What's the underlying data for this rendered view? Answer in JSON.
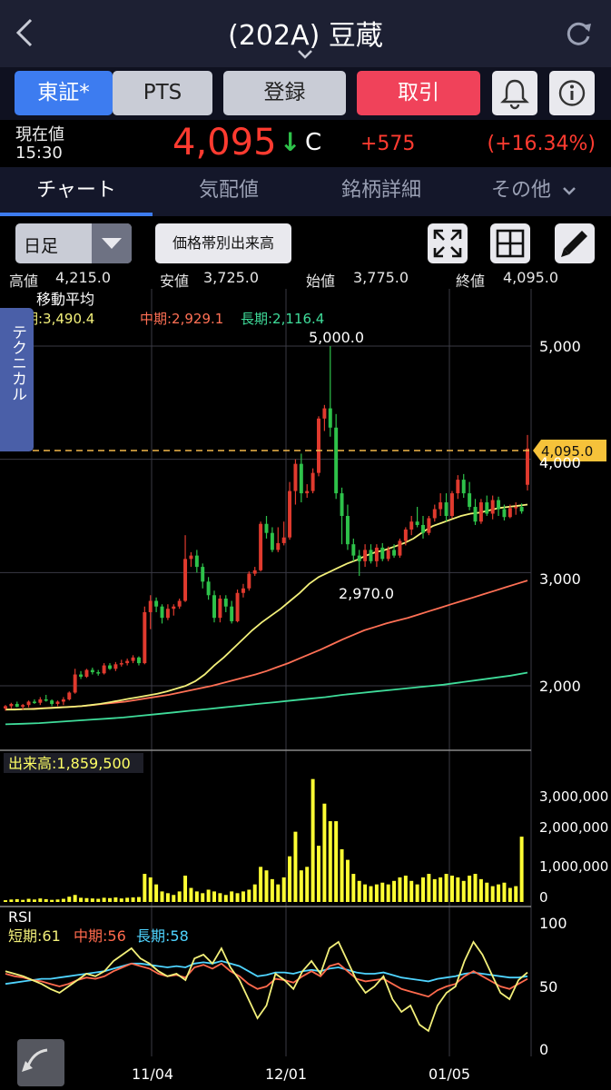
{
  "header": {
    "back_icon": "chevron-left-icon",
    "title": "(202A) 豆蔵",
    "reload_icon": "reload-icon"
  },
  "buttons": {
    "tse": "東証*",
    "pts": "PTS",
    "register": "登録",
    "trade": "取引",
    "bell_icon": "bell-icon",
    "info_icon": "info-icon"
  },
  "quote": {
    "label": "現在値",
    "time": "15:30",
    "price": "4,095",
    "arrow": "↓",
    "flag": "C",
    "change": "+575",
    "change_pct": "(+16.34%)"
  },
  "tabs": [
    {
      "label": "チャート",
      "active": true
    },
    {
      "label": "気配値"
    },
    {
      "label": "銘柄詳細"
    },
    {
      "label": "その他"
    }
  ],
  "toolbar": {
    "period": "日足",
    "volume_by_price": "価格帯別出来高",
    "expand_icon": "expand-icon",
    "grid_icon": "grid-icon",
    "pencil_icon": "pencil-icon"
  },
  "ohlc": {
    "high_label": "高値",
    "high": "4,215.0",
    "low_label": "安値",
    "low": "3,725.0",
    "open_label": "始値",
    "open": "3,775.0",
    "close_label": "終値",
    "close": "4,095.0"
  },
  "price_panel": {
    "ma_title": "移動平均",
    "ma_short": "短期:3,490.4",
    "ma_mid": "中期:2,929.1",
    "ma_long": "長期:2,116.4",
    "side_tab": "テクニカル",
    "max_label": "5,000.0",
    "min_label": "2,970.0",
    "current_tag": "4,095.0",
    "yticks": [
      "5,000",
      "4,000",
      "3,000",
      "2,000"
    ]
  },
  "volume_panel": {
    "label": "出来高:1,859,500",
    "yticks": [
      "3,000,000",
      "2,000,000",
      "1,000,000",
      "0"
    ]
  },
  "rsi_panel": {
    "title": "RSI",
    "short": "短期:61",
    "mid": "中期:56",
    "long": "長期:58",
    "yticks": [
      "100",
      "50",
      "0"
    ]
  },
  "xaxis": [
    "11/04",
    "12/01",
    "01/05"
  ],
  "colors": {
    "up": "#e03a2e",
    "down": "#2ec24a",
    "ma_short": "#f3f07a",
    "ma_mid": "#ff7055",
    "ma_long": "#3fdc9a",
    "volume": "#ffff33",
    "rsi_short": "#f3f07a",
    "rsi_mid": "#ff6a4d",
    "rsi_long": "#4fd4ff"
  },
  "chart_data": {
    "type": "candlestick",
    "ylim": [
      1700,
      5500
    ],
    "candles": [
      {
        "o": 1800,
        "h": 1830,
        "l": 1780,
        "c": 1820
      },
      {
        "o": 1820,
        "h": 1850,
        "l": 1800,
        "c": 1840
      },
      {
        "o": 1840,
        "h": 1860,
        "l": 1810,
        "c": 1815
      },
      {
        "o": 1815,
        "h": 1840,
        "l": 1790,
        "c": 1830
      },
      {
        "o": 1830,
        "h": 1870,
        "l": 1810,
        "c": 1860
      },
      {
        "o": 1860,
        "h": 1880,
        "l": 1840,
        "c": 1850
      },
      {
        "o": 1850,
        "h": 1900,
        "l": 1830,
        "c": 1880
      },
      {
        "o": 1880,
        "h": 1920,
        "l": 1860,
        "c": 1870
      },
      {
        "o": 1870,
        "h": 1880,
        "l": 1820,
        "c": 1840
      },
      {
        "o": 1840,
        "h": 1870,
        "l": 1820,
        "c": 1860
      },
      {
        "o": 1860,
        "h": 1900,
        "l": 1830,
        "c": 1880
      },
      {
        "o": 1880,
        "h": 1950,
        "l": 1870,
        "c": 1940
      },
      {
        "o": 1940,
        "h": 2150,
        "l": 1930,
        "c": 2100
      },
      {
        "o": 2100,
        "h": 2130,
        "l": 2060,
        "c": 2080
      },
      {
        "o": 2080,
        "h": 2150,
        "l": 2070,
        "c": 2140
      },
      {
        "o": 2140,
        "h": 2160,
        "l": 2100,
        "c": 2120
      },
      {
        "o": 2120,
        "h": 2140,
        "l": 2090,
        "c": 2110
      },
      {
        "o": 2110,
        "h": 2200,
        "l": 2100,
        "c": 2180
      },
      {
        "o": 2180,
        "h": 2200,
        "l": 2140,
        "c": 2150
      },
      {
        "o": 2150,
        "h": 2210,
        "l": 2130,
        "c": 2190
      },
      {
        "o": 2190,
        "h": 2230,
        "l": 2170,
        "c": 2200
      },
      {
        "o": 2200,
        "h": 2240,
        "l": 2180,
        "c": 2220
      },
      {
        "o": 2220,
        "h": 2270,
        "l": 2200,
        "c": 2250
      },
      {
        "o": 2250,
        "h": 2260,
        "l": 2180,
        "c": 2200
      },
      {
        "o": 2200,
        "h": 2700,
        "l": 2190,
        "c": 2650
      },
      {
        "o": 2650,
        "h": 2800,
        "l": 2500,
        "c": 2750
      },
      {
        "o": 2750,
        "h": 2780,
        "l": 2650,
        "c": 2700
      },
      {
        "o": 2700,
        "h": 2720,
        "l": 2550,
        "c": 2600
      },
      {
        "o": 2600,
        "h": 2720,
        "l": 2580,
        "c": 2680
      },
      {
        "o": 2680,
        "h": 2720,
        "l": 2620,
        "c": 2700
      },
      {
        "o": 2700,
        "h": 2770,
        "l": 2680,
        "c": 2750
      },
      {
        "o": 2750,
        "h": 3330,
        "l": 2740,
        "c": 3120
      },
      {
        "o": 3120,
        "h": 3180,
        "l": 3050,
        "c": 3150
      },
      {
        "o": 3150,
        "h": 3200,
        "l": 3000,
        "c": 3050
      },
      {
        "o": 3050,
        "h": 3080,
        "l": 2860,
        "c": 2920
      },
      {
        "o": 2920,
        "h": 2960,
        "l": 2760,
        "c": 2800
      },
      {
        "o": 2800,
        "h": 2840,
        "l": 2560,
        "c": 2600
      },
      {
        "o": 2600,
        "h": 2800,
        "l": 2560,
        "c": 2770
      },
      {
        "o": 2770,
        "h": 2800,
        "l": 2650,
        "c": 2700
      },
      {
        "o": 2700,
        "h": 2750,
        "l": 2550,
        "c": 2570
      },
      {
        "o": 2570,
        "h": 2850,
        "l": 2560,
        "c": 2820
      },
      {
        "o": 2820,
        "h": 2900,
        "l": 2780,
        "c": 2860
      },
      {
        "o": 2860,
        "h": 3010,
        "l": 2840,
        "c": 2990
      },
      {
        "o": 2990,
        "h": 3050,
        "l": 2970,
        "c": 3020
      },
      {
        "o": 3020,
        "h": 3450,
        "l": 3010,
        "c": 3430
      },
      {
        "o": 3430,
        "h": 3500,
        "l": 3300,
        "c": 3350
      },
      {
        "o": 3350,
        "h": 3400,
        "l": 3180,
        "c": 3200
      },
      {
        "o": 3200,
        "h": 3400,
        "l": 3180,
        "c": 3260
      },
      {
        "o": 3260,
        "h": 3450,
        "l": 3240,
        "c": 3310
      },
      {
        "o": 3310,
        "h": 3800,
        "l": 3290,
        "c": 3720
      },
      {
        "o": 3720,
        "h": 4000,
        "l": 3600,
        "c": 3960
      },
      {
        "o": 3960,
        "h": 4050,
        "l": 3620,
        "c": 3700
      },
      {
        "o": 3700,
        "h": 3780,
        "l": 3660,
        "c": 3720
      },
      {
        "o": 3720,
        "h": 3920,
        "l": 3700,
        "c": 3880
      },
      {
        "o": 3880,
        "h": 4380,
        "l": 3850,
        "c": 4360
      },
      {
        "o": 4360,
        "h": 4480,
        "l": 4250,
        "c": 4450
      },
      {
        "o": 4450,
        "h": 5000,
        "l": 4200,
        "c": 4280
      },
      {
        "o": 4280,
        "h": 4400,
        "l": 3650,
        "c": 3700
      },
      {
        "o": 3700,
        "h": 3750,
        "l": 3250,
        "c": 3500
      },
      {
        "o": 3500,
        "h": 3600,
        "l": 3200,
        "c": 3250
      },
      {
        "o": 3250,
        "h": 3300,
        "l": 3100,
        "c": 3150
      },
      {
        "o": 3150,
        "h": 3200,
        "l": 2970,
        "c": 3100
      },
      {
        "o": 3100,
        "h": 3250,
        "l": 3050,
        "c": 3200
      },
      {
        "o": 3200,
        "h": 3250,
        "l": 3080,
        "c": 3100
      },
      {
        "o": 3100,
        "h": 3250,
        "l": 3050,
        "c": 3220
      },
      {
        "o": 3220,
        "h": 3260,
        "l": 3100,
        "c": 3120
      },
      {
        "o": 3120,
        "h": 3230,
        "l": 3100,
        "c": 3200
      },
      {
        "o": 3200,
        "h": 3250,
        "l": 3130,
        "c": 3150
      },
      {
        "o": 3150,
        "h": 3300,
        "l": 3130,
        "c": 3280
      },
      {
        "o": 3280,
        "h": 3400,
        "l": 3240,
        "c": 3380
      },
      {
        "o": 3380,
        "h": 3500,
        "l": 3330,
        "c": 3450
      },
      {
        "o": 3450,
        "h": 3580,
        "l": 3400,
        "c": 3420
      },
      {
        "o": 3420,
        "h": 3500,
        "l": 3300,
        "c": 3350
      },
      {
        "o": 3350,
        "h": 3500,
        "l": 3330,
        "c": 3480
      },
      {
        "o": 3480,
        "h": 3600,
        "l": 3450,
        "c": 3560
      },
      {
        "o": 3560,
        "h": 3700,
        "l": 3500,
        "c": 3620
      },
      {
        "o": 3620,
        "h": 3700,
        "l": 3450,
        "c": 3500
      },
      {
        "o": 3500,
        "h": 3720,
        "l": 3480,
        "c": 3700
      },
      {
        "o": 3700,
        "h": 3860,
        "l": 3650,
        "c": 3820
      },
      {
        "o": 3820,
        "h": 3870,
        "l": 3660,
        "c": 3700
      },
      {
        "o": 3700,
        "h": 3800,
        "l": 3550,
        "c": 3580
      },
      {
        "o": 3580,
        "h": 3650,
        "l": 3420,
        "c": 3450
      },
      {
        "o": 3450,
        "h": 3650,
        "l": 3430,
        "c": 3620
      },
      {
        "o": 3620,
        "h": 3680,
        "l": 3500,
        "c": 3520
      },
      {
        "o": 3520,
        "h": 3680,
        "l": 3470,
        "c": 3640
      },
      {
        "o": 3640,
        "h": 3670,
        "l": 3500,
        "c": 3560
      },
      {
        "o": 3560,
        "h": 3600,
        "l": 3460,
        "c": 3490
      },
      {
        "o": 3490,
        "h": 3600,
        "l": 3480,
        "c": 3570
      },
      {
        "o": 3570,
        "h": 3620,
        "l": 3510,
        "c": 3580
      },
      {
        "o": 3580,
        "h": 3610,
        "l": 3520,
        "c": 3540
      },
      {
        "o": 3775,
        "h": 4215,
        "l": 3725,
        "c": 4095
      }
    ],
    "volume": [
      50,
      70,
      80,
      60,
      90,
      70,
      100,
      80,
      60,
      70,
      90,
      150,
      200,
      120,
      110,
      100,
      90,
      120,
      110,
      130,
      100,
      120,
      130,
      140,
      800,
      700,
      500,
      300,
      250,
      200,
      300,
      750,
      400,
      300,
      250,
      350,
      300,
      250,
      200,
      300,
      250,
      300,
      350,
      500,
      1000,
      900,
      650,
      500,
      700,
      1300,
      2000,
      900,
      1000,
      3500,
      1600,
      2800,
      2300,
      2300,
      1500,
      1200,
      800,
      600,
      500,
      450,
      500,
      550,
      500,
      600,
      700,
      750,
      600,
      500,
      700,
      800,
      650,
      700,
      800,
      750,
      700,
      600,
      750,
      800,
      650,
      550,
      450,
      500,
      550,
      400,
      450,
      1859.5
    ],
    "volume_unit": "thousand shares",
    "volume_ylim": [
      0,
      4000
    ],
    "ma_short": [
      1790,
      1790,
      1795,
      1795,
      1800,
      1805,
      1810,
      1815,
      1820,
      1830,
      1840,
      1855,
      1870,
      1885,
      1900,
      1915,
      1930,
      1950,
      1975,
      2000,
      2040,
      2100,
      2180,
      2250,
      2330,
      2410,
      2490,
      2560,
      2620,
      2680,
      2750,
      2820,
      2900,
      2960,
      3000,
      3040,
      3080,
      3110,
      3150,
      3180,
      3200,
      3230,
      3260,
      3300,
      3360,
      3410,
      3440,
      3470,
      3500,
      3520,
      3530,
      3550,
      3570,
      3580,
      3590,
      3600
    ],
    "ma_mid": [
      1790,
      1792,
      1795,
      1800,
      1805,
      1810,
      1815,
      1820,
      1830,
      1840,
      1850,
      1860,
      1875,
      1890,
      1905,
      1920,
      1940,
      1960,
      1980,
      2000,
      2025,
      2050,
      2075,
      2100,
      2130,
      2165,
      2200,
      2240,
      2280,
      2320,
      2365,
      2410,
      2450,
      2490,
      2520,
      2550,
      2575,
      2600,
      2630,
      2660,
      2690,
      2720,
      2750,
      2780,
      2810,
      2840,
      2870,
      2900,
      2930
    ],
    "ma_long": [
      1660,
      1665,
      1670,
      1680,
      1690,
      1700,
      1710,
      1720,
      1735,
      1750,
      1765,
      1780,
      1795,
      1810,
      1825,
      1840,
      1855,
      1870,
      1885,
      1900,
      1920,
      1935,
      1950,
      1965,
      1980,
      1995,
      2010,
      2030,
      2050,
      2070,
      2090,
      2116.4
    ],
    "rsi_short": [
      62,
      60,
      58,
      55,
      52,
      48,
      45,
      50,
      55,
      60,
      58,
      62,
      70,
      75,
      80,
      72,
      68,
      62,
      58,
      60,
      55,
      72,
      75,
      68,
      80,
      65,
      55,
      40,
      25,
      35,
      60,
      55,
      48,
      62,
      70,
      60,
      80,
      85,
      70,
      55,
      45,
      50,
      58,
      40,
      30,
      35,
      20,
      15,
      35,
      45,
      50,
      70,
      85,
      75,
      60,
      45,
      40,
      55,
      61
    ],
    "rsi_mid": [
      60,
      58,
      57,
      55,
      54,
      52,
      50,
      52,
      55,
      57,
      56,
      58,
      62,
      65,
      68,
      66,
      64,
      60,
      58,
      59,
      57,
      65,
      67,
      64,
      68,
      62,
      58,
      52,
      48,
      50,
      56,
      55,
      53,
      58,
      62,
      58,
      66,
      68,
      62,
      56,
      54,
      55,
      56,
      52,
      48,
      46,
      44,
      42,
      47,
      50,
      52,
      58,
      62,
      58,
      54,
      50,
      48,
      52,
      56
    ],
    "rsi_long": [
      52,
      53,
      54,
      55,
      56,
      56,
      57,
      58,
      59,
      60,
      61,
      62,
      64,
      66,
      68,
      68,
      67,
      66,
      65,
      66,
      65,
      68,
      69,
      68,
      70,
      68,
      66,
      62,
      58,
      59,
      61,
      61,
      60,
      62,
      63,
      62,
      64,
      65,
      63,
      61,
      60,
      60,
      61,
      59,
      57,
      56,
      55,
      54,
      56,
      57,
      58,
      60,
      61,
      60,
      59,
      58,
      57,
      57,
      58
    ],
    "rsi_ylim": [
      0,
      100
    ]
  }
}
